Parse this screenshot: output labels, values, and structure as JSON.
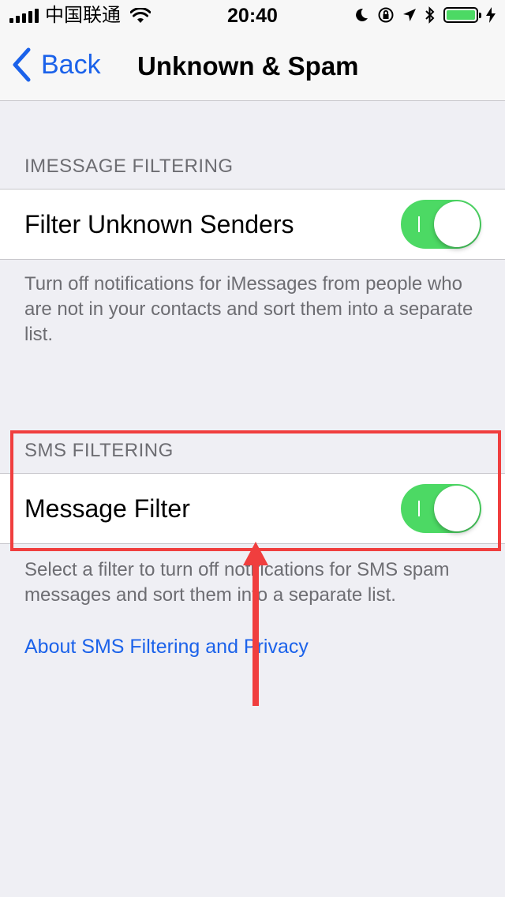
{
  "status_bar": {
    "carrier": "中国联通",
    "time": "20:40",
    "icons": [
      "signal-icon",
      "wifi-icon",
      "moon-icon",
      "orientation-lock-icon",
      "location-icon",
      "bluetooth-icon",
      "battery-icon",
      "charging-icon"
    ]
  },
  "nav": {
    "back_label": "Back",
    "title": "Unknown & Spam"
  },
  "imessage": {
    "header": "IMESSAGE FILTERING",
    "row_label": "Filter Unknown Senders",
    "toggle_on": true,
    "footer": "Turn off notifications for iMessages from people who are not in your contacts and sort them into a separate list."
  },
  "sms": {
    "header": "SMS FILTERING",
    "row_label": "Message Filter",
    "toggle_on": true,
    "footer": "Select a filter to turn off notifications for SMS spam messages and sort them into a separate list.",
    "link": "About SMS Filtering and Privacy"
  },
  "colors": {
    "accent": "#1b62ea",
    "switch_on": "#4cd964",
    "annotation": "#f03e3e",
    "background": "#efeff4"
  }
}
